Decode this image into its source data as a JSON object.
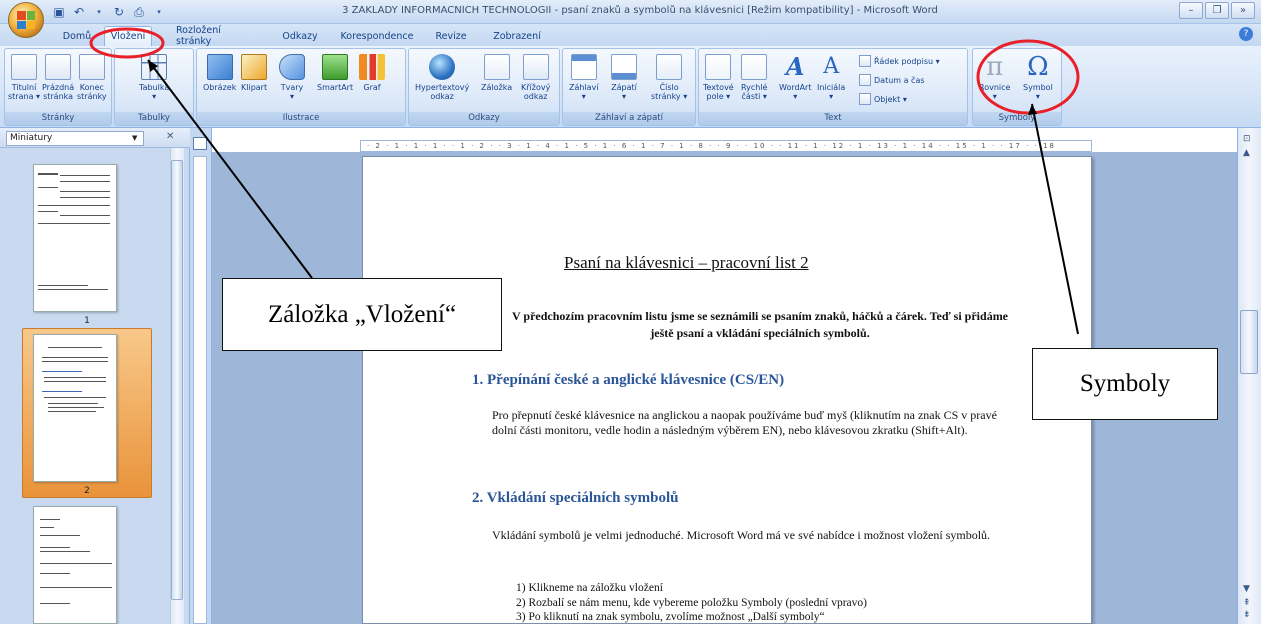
{
  "window": {
    "title": "3 ZÁKLADY INFORMAČNÍCH TECHNOLOGIÍ - psaní znaků a symbolů na klávesnici [Režim kompatibility] - Microsoft Word"
  },
  "ribbon_tabs": [
    "Domů",
    "Vložení",
    "Rozložení stránky",
    "Odkazy",
    "Korespondence",
    "Revize",
    "Zobrazení"
  ],
  "ribbon": {
    "groups": [
      {
        "label": "Stránky",
        "buttons": [
          [
            "Titulní",
            "strana ▾"
          ],
          [
            "Prázdná",
            "stránka"
          ],
          [
            "Konec",
            "stránky"
          ]
        ]
      },
      {
        "label": "Tabulky",
        "buttons": [
          [
            "Tabulka",
            "▾"
          ]
        ]
      },
      {
        "label": "Ilustrace",
        "buttons": [
          [
            "Obrázek",
            ""
          ],
          [
            "Klipart",
            ""
          ],
          [
            "Tvary",
            "▾"
          ],
          [
            "SmartArt",
            ""
          ],
          [
            "Graf",
            ""
          ]
        ]
      },
      {
        "label": "Odkazy",
        "buttons": [
          [
            "Hypertextový",
            "odkaz"
          ],
          [
            "Záložka",
            ""
          ],
          [
            "Křížový",
            "odkaz"
          ]
        ]
      },
      {
        "label": "Záhlaví a zápatí",
        "buttons": [
          [
            "Záhlaví",
            "▾"
          ],
          [
            "Zápatí",
            "▾"
          ],
          [
            "Číslo",
            "stránky ▾"
          ]
        ]
      },
      {
        "label": "Text",
        "buttons": [
          [
            "Textové",
            "pole ▾"
          ],
          [
            "Rychlé",
            "části ▾"
          ],
          [
            "WordArt",
            "▾"
          ],
          [
            "Iniciála",
            "▾"
          ]
        ],
        "small": [
          "Řádek podpisu ▾",
          "Datum a čas",
          "Objekt ▾"
        ]
      },
      {
        "label": "Symboly",
        "buttons": [
          [
            "Rovnice",
            "▾"
          ],
          [
            "Symbol",
            "▾"
          ]
        ]
      }
    ]
  },
  "thumbnails": {
    "view_label": "Miniatury",
    "pages": [
      "1",
      "2"
    ]
  },
  "ruler_text": "· 2 · 1 · 1 · 1 · · 1 · 2 · · 3 · 1 · 4 · 1 · 5 · 1 · 6 · 1 · 7 · 1 · 8 · · 9 · · 10 · · 11 · 1 · 12 · 1 · 13 · 1 · 14 · · 15 · 1 · · 17 · · 18",
  "document": {
    "title": "Psaní na klávesnici – pracovní list 2",
    "intro": "V předchozím pracovním listu jsme se seznámili se psaním znaků, háčků a čárek. Teď si přidáme ještě psaní a vkládání speciálních symbolů.",
    "section1": {
      "title": "1.  Přepínání české a anglické klávesnice (CS/EN)",
      "text": "Pro přepnutí české klávesnice na anglickou a naopak používáme buď myš (kliknutím na znak CS v pravé dolní části monitoru, vedle hodin a následným výběrem EN), nebo klávesovou zkratku (Shift+Alt)."
    },
    "section2": {
      "title": "2.  Vkládání speciálních symbolů",
      "text": "Vkládání symbolů je velmi jednoduché. Microsoft Word má ve své nabídce i možnost vložení symbolů.",
      "steps": [
        "1)  Klikneme na záložku vložení",
        "2)  Rozbalí se nám menu, kde vybereme položku Symboly (poslední vpravo)",
        "3)  Po kliknutí na znak symbolu, zvolíme možnost „Další symboly“"
      ]
    }
  },
  "annotations": {
    "vlozeni": "Záložka „Vložení“",
    "symboly": "Symboly"
  },
  "colors": {
    "highlight_circle": "#e8202a",
    "ribbon_text": "#15428b",
    "heading_blue": "#2a5599",
    "selected_thumb": "#e9933a"
  }
}
